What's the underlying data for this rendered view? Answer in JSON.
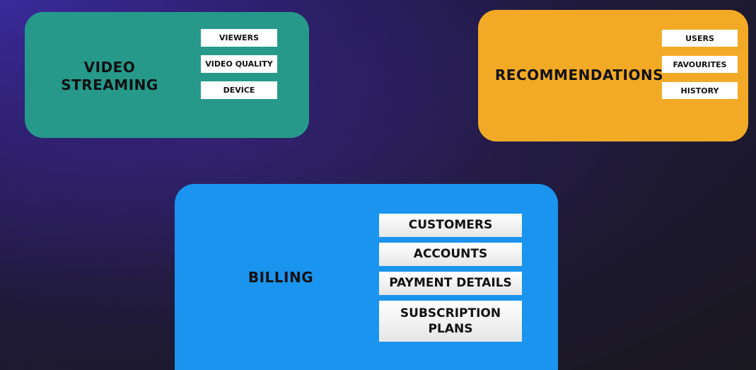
{
  "cards": {
    "video_streaming": {
      "title": "VIDEO\nSTREAMING",
      "color": "#26998a",
      "tags": [
        "VIEWERS",
        "VIDEO QUALITY",
        "DEVICE"
      ]
    },
    "recommendations": {
      "title": "RECOMMENDATIONS",
      "color": "#f2aa26",
      "tags": [
        "USERS",
        "FAVOURITES",
        "HISTORY"
      ]
    },
    "billing": {
      "title": "BILLING",
      "color": "#1a94ee",
      "tags": [
        "CUSTOMERS",
        "ACCOUNTS",
        "PAYMENT DETAILS",
        "SUBSCRIPTION\nPLANS"
      ]
    }
  }
}
